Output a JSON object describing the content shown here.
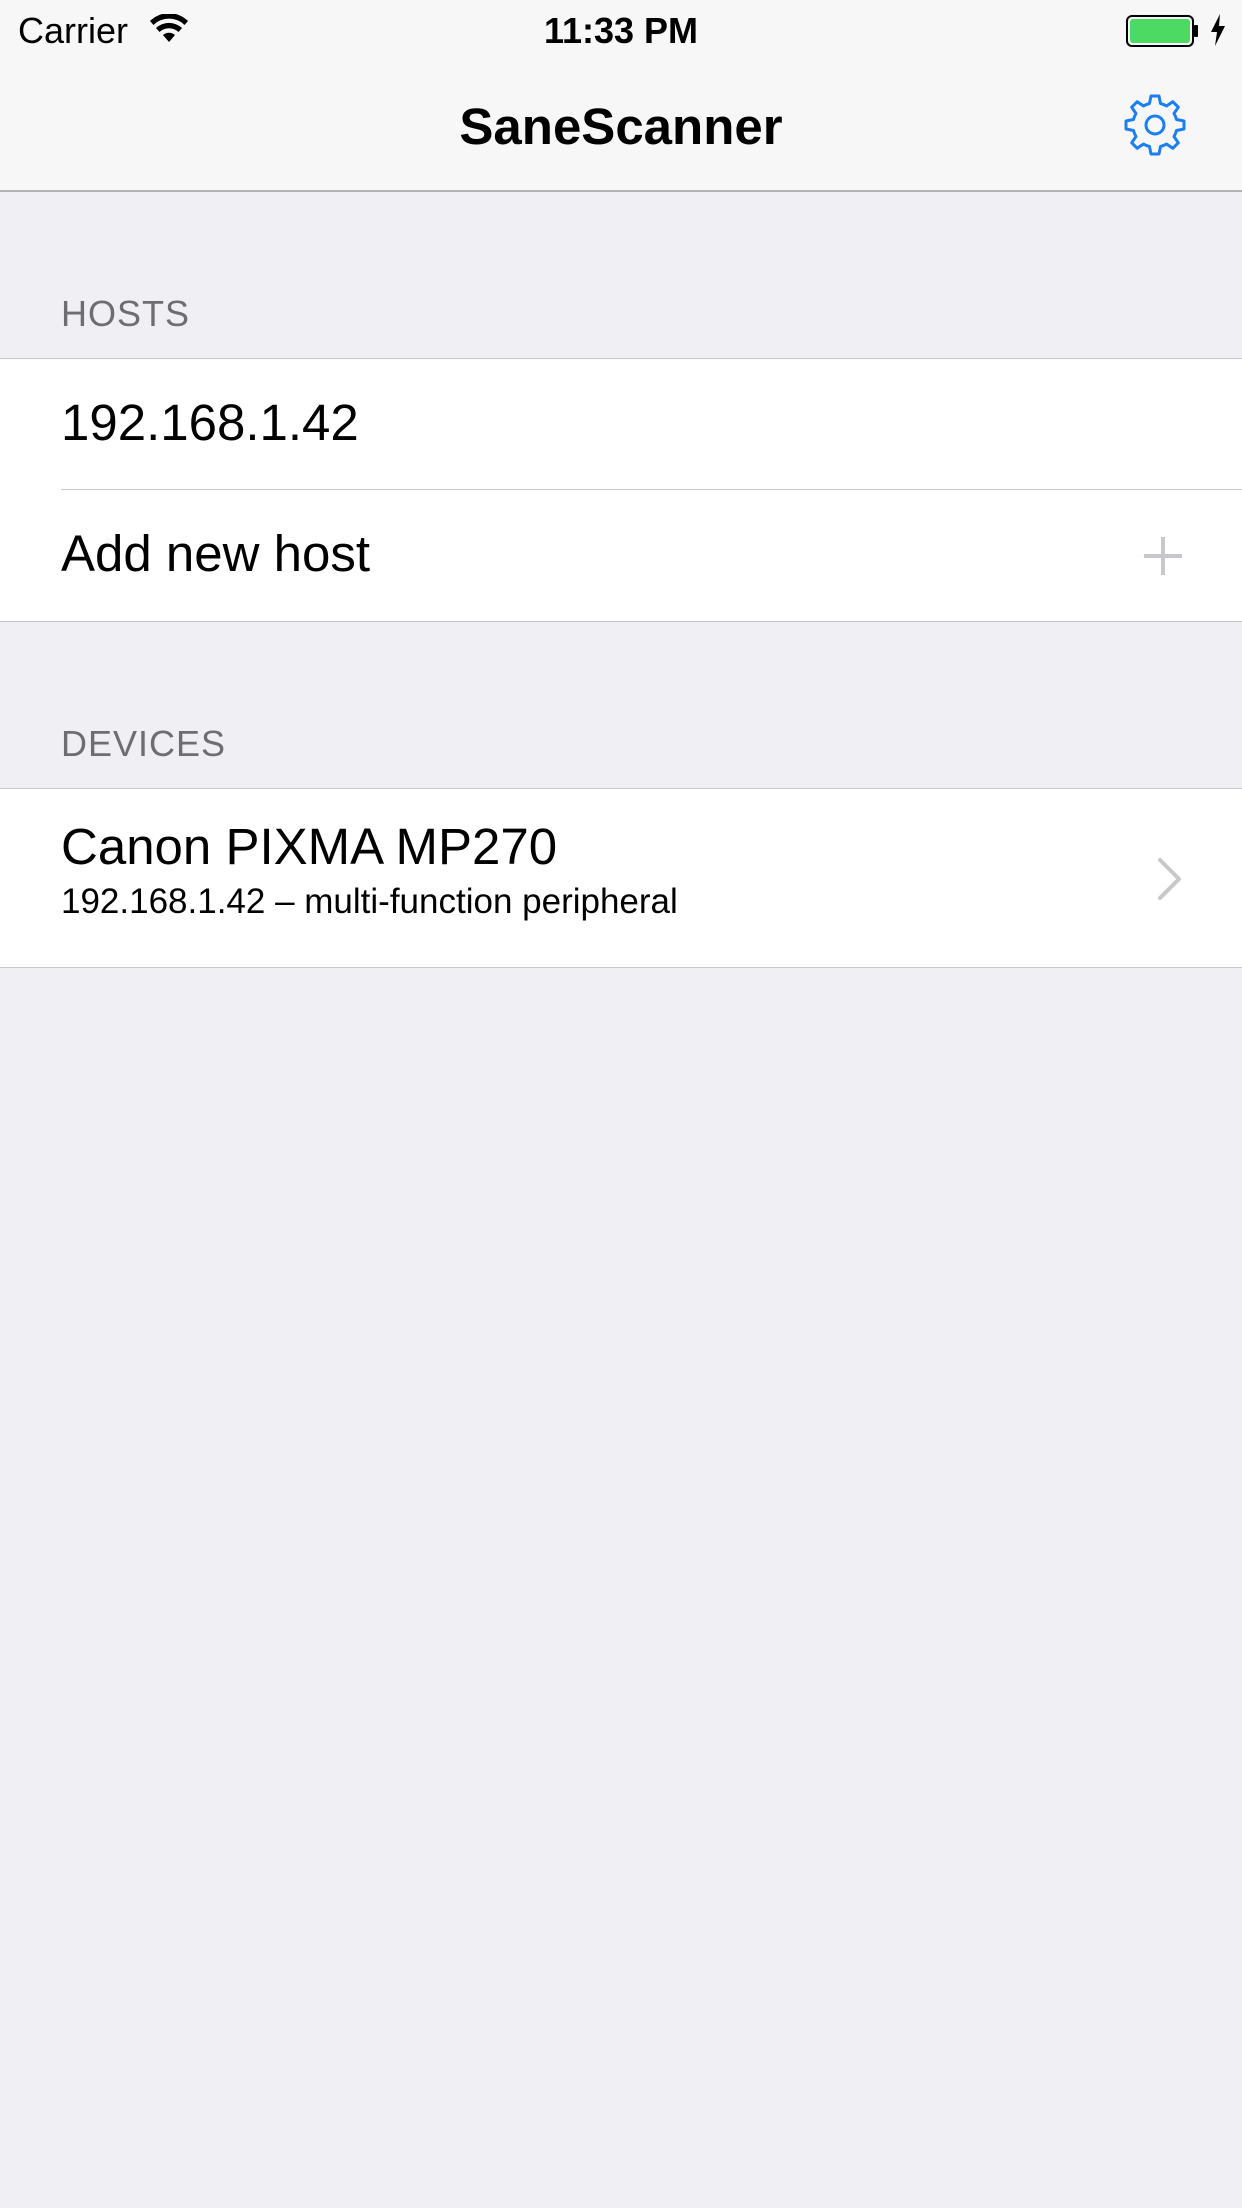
{
  "status_bar": {
    "carrier": "Carrier",
    "time": "11:33 PM",
    "battery_color": "#4cd964"
  },
  "nav": {
    "title": "SaneScanner",
    "settings_icon": "gear-icon",
    "accent_color": "#1a7ff0"
  },
  "hosts": {
    "header": "HOSTS",
    "items": [
      {
        "label": "192.168.1.42"
      }
    ],
    "add_label": "Add new host"
  },
  "devices": {
    "header": "DEVICES",
    "items": [
      {
        "name": "Canon PIXMA MP270",
        "detail": "192.168.1.42 – multi-function peripheral"
      }
    ]
  }
}
